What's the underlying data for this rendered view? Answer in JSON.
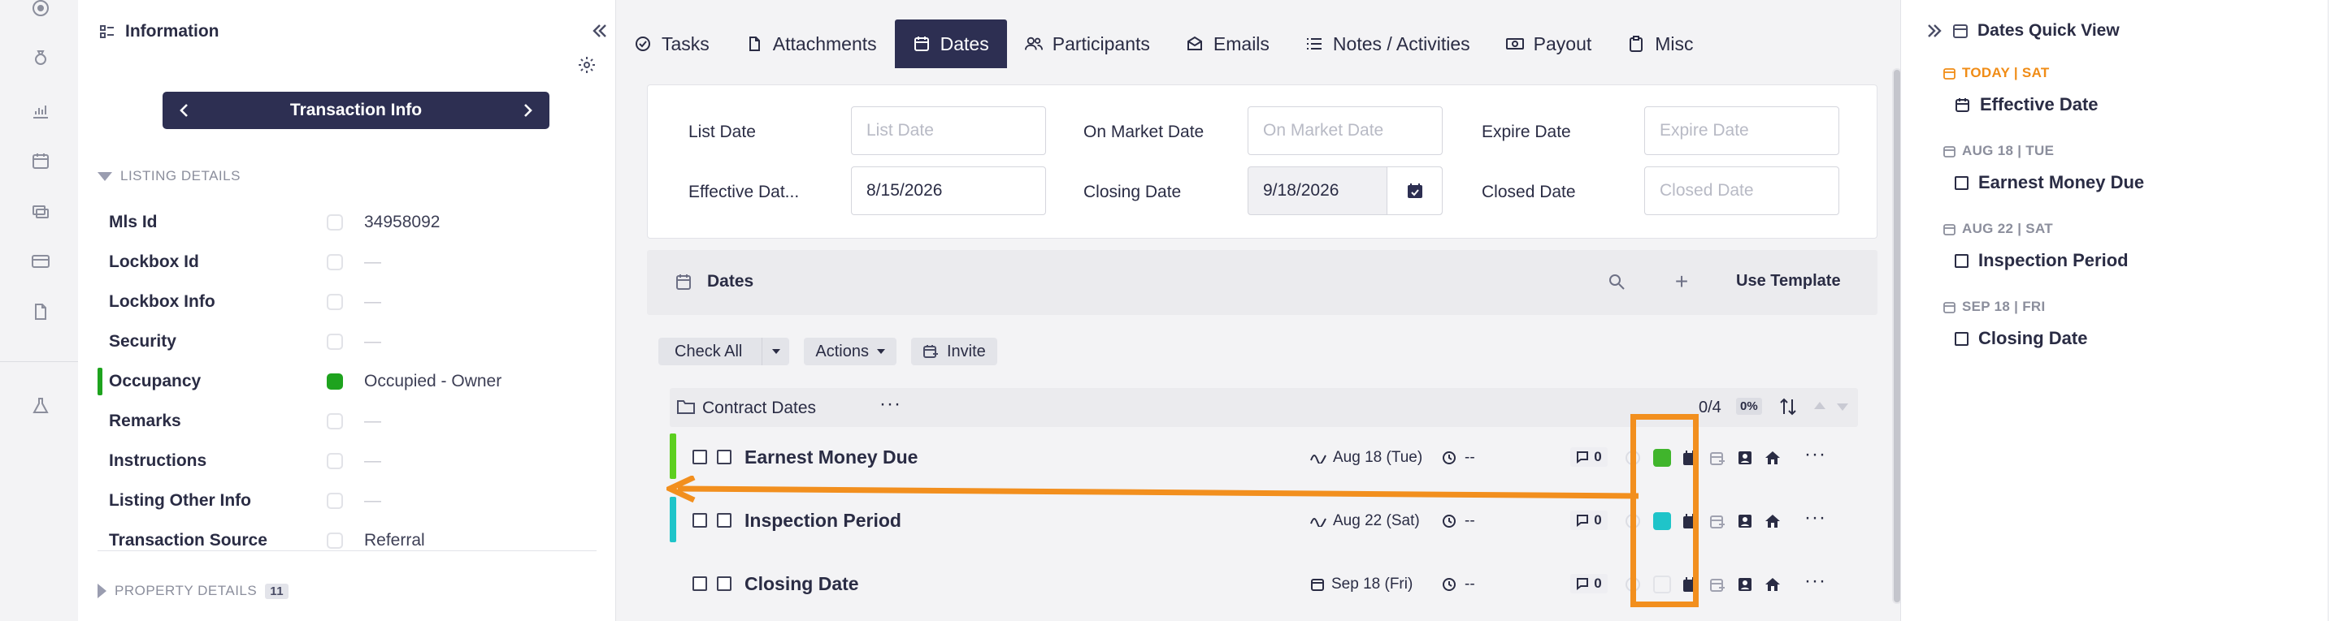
{
  "info_panel": {
    "title": "Information",
    "nav_title": "Transaction Info",
    "listing_section": "LISTING DETAILS",
    "property_section": "PROPERTY DETAILS",
    "property_count": "11",
    "fields": [
      {
        "label": "Mls Id",
        "value": "34958092",
        "checked": false,
        "empty": false
      },
      {
        "label": "Lockbox Id",
        "value": "—",
        "checked": false,
        "empty": true
      },
      {
        "label": "Lockbox Info",
        "value": "—",
        "checked": false,
        "empty": true
      },
      {
        "label": "Security",
        "value": "—",
        "checked": false,
        "empty": true
      },
      {
        "label": "Occupancy",
        "value": "Occupied - Owner",
        "checked": true,
        "empty": false
      },
      {
        "label": "Remarks",
        "value": "—",
        "checked": false,
        "empty": true
      },
      {
        "label": "Instructions",
        "value": "—",
        "checked": false,
        "empty": true
      },
      {
        "label": "Listing Other Info",
        "value": "—",
        "checked": false,
        "empty": true
      },
      {
        "label": "Transaction Source",
        "value": "Referral",
        "checked": false,
        "empty": false
      }
    ]
  },
  "tabs": [
    {
      "label": "Tasks",
      "icon": "check-circle-icon",
      "active": false
    },
    {
      "label": "Attachments",
      "icon": "file-icon",
      "active": false
    },
    {
      "label": "Dates",
      "icon": "calendar-icon",
      "active": true
    },
    {
      "label": "Participants",
      "icon": "people-icon",
      "active": false
    },
    {
      "label": "Emails",
      "icon": "mail-icon",
      "active": false
    },
    {
      "label": "Notes / Activities",
      "icon": "list-icon",
      "active": false
    },
    {
      "label": "Payout",
      "icon": "money-icon",
      "active": false
    },
    {
      "label": "Misc",
      "icon": "clipboard-icon",
      "active": false
    }
  ],
  "date_form": {
    "list_date": {
      "label": "List Date",
      "placeholder": "List Date",
      "value": ""
    },
    "on_market_date": {
      "label": "On Market Date",
      "placeholder": "On Market Date",
      "value": ""
    },
    "expire_date": {
      "label": "Expire Date",
      "placeholder": "Expire Date",
      "value": ""
    },
    "effective_date": {
      "label": "Effective Dat...",
      "placeholder": "",
      "value": "8/15/2026"
    },
    "closing_date": {
      "label": "Closing Date",
      "placeholder": "",
      "value": "9/18/2026"
    },
    "closed_date": {
      "label": "Closed Date",
      "placeholder": "Closed Date",
      "value": ""
    }
  },
  "dates_bar": {
    "title": "Dates",
    "use_template": "Use Template"
  },
  "actions": {
    "check_all": "Check All",
    "actions": "Actions",
    "invite": "Invite"
  },
  "group": {
    "title": "Contract Dates",
    "count": "0/4",
    "pct": "0%"
  },
  "rows": [
    {
      "name": "Earnest Money Due",
      "due": "Aug 18 (Tue)",
      "time": "--",
      "comments": "0",
      "color": "#5ccf1f",
      "status_color": "#40b52c"
    },
    {
      "name": "Inspection Period",
      "due": "Aug 22 (Sat)",
      "time": "--",
      "comments": "0",
      "color": "#1fc4c9",
      "status_color": "#1fc4c9"
    },
    {
      "name": "Closing Date",
      "due": "Sep 18 (Fri)",
      "time": "--",
      "comments": "0",
      "color": "",
      "status_color": ""
    }
  ],
  "quick_view": {
    "title": "Dates Quick View",
    "entries": [
      {
        "date": "TODAY | SAT",
        "item": "Effective Date",
        "today": true
      },
      {
        "date": "AUG 18 | TUE",
        "item": "Earnest Money Due",
        "today": false
      },
      {
        "date": "AUG 22 | SAT",
        "item": "Inspection Period",
        "today": false
      },
      {
        "date": "SEP 18 | FRI",
        "item": "Closing Date",
        "today": false
      }
    ]
  },
  "colors": {
    "accent": "#2d2f52",
    "highlight": "#f28f1e",
    "green": "#1ea31e",
    "today": "#f08c16"
  }
}
